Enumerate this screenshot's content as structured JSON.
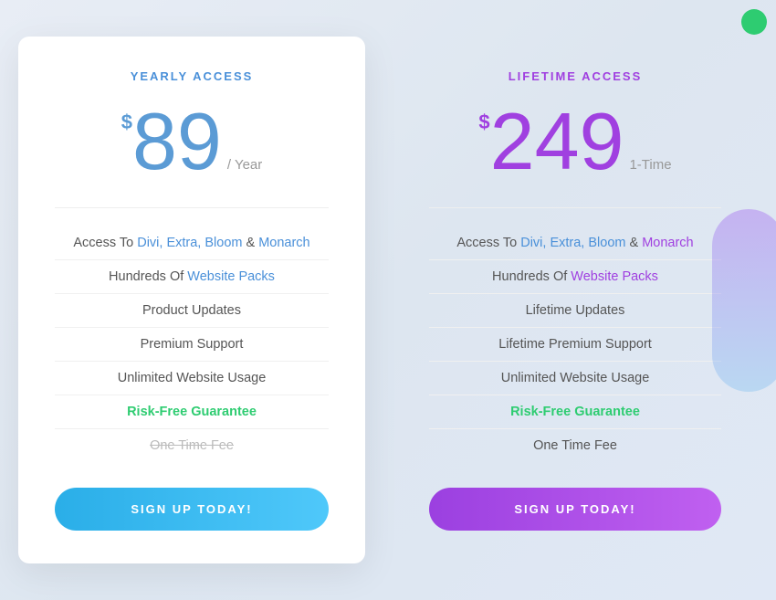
{
  "background": {
    "circle_color": "#2ecc71"
  },
  "yearly": {
    "plan_label": "YEARLY ACCESS",
    "price_dollar": "$",
    "price_number": "89",
    "price_period": "/ Year",
    "features": [
      {
        "text_plain": "Access To ",
        "text_links": "Divi, Extra, Bloom & Monarch",
        "type": "links_blue_purple"
      },
      {
        "text_plain": "Hundreds Of ",
        "text_link": "Website Packs",
        "type": "link_blue"
      },
      {
        "text": "Product Updates",
        "type": "plain"
      },
      {
        "text": "Premium Support",
        "type": "plain"
      },
      {
        "text": "Unlimited Website Usage",
        "type": "plain"
      },
      {
        "text": "Risk-Free Guarantee",
        "type": "green"
      },
      {
        "text": "One Time Fee",
        "type": "strikethrough"
      }
    ],
    "cta": "SIGN UP TODAY!"
  },
  "lifetime": {
    "plan_label": "LIFETIME ACCESS",
    "price_dollar": "$",
    "price_number": "249",
    "price_period": "1-Time",
    "features": [
      {
        "text_plain": "Access To ",
        "text_links": "Divi, Extra, Bloom & Monarch",
        "type": "links_blue_purple"
      },
      {
        "text_plain": "Hundreds Of ",
        "text_link": "Website Packs",
        "type": "link_purple"
      },
      {
        "text": "Lifetime Updates",
        "type": "plain"
      },
      {
        "text": "Lifetime Premium Support",
        "type": "plain"
      },
      {
        "text": "Unlimited Website Usage",
        "type": "plain"
      },
      {
        "text": "Risk-Free Guarantee",
        "type": "green"
      },
      {
        "text": "One Time Fee",
        "type": "plain"
      }
    ],
    "cta": "SIGN UP TODAY!"
  }
}
